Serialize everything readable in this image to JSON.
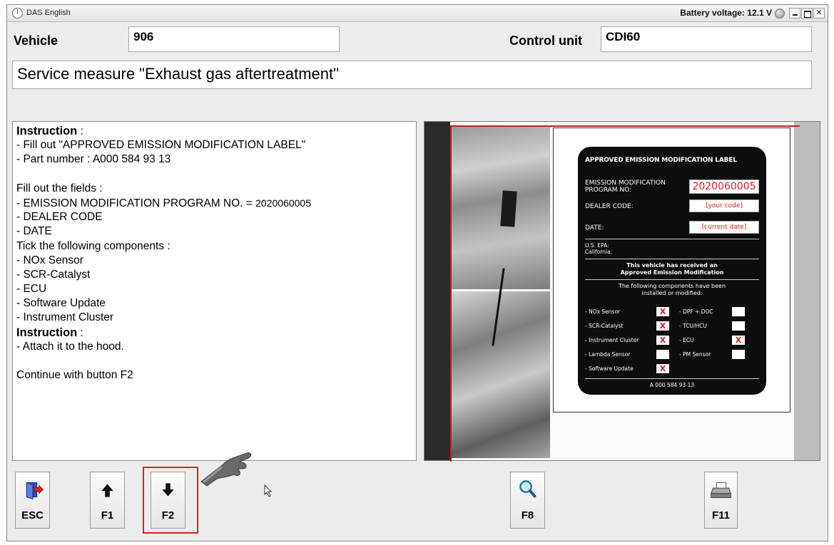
{
  "window": {
    "title": "DAS English",
    "battery": "Battery voltage: 12.1 V"
  },
  "header": {
    "vehicle_label": "Vehicle",
    "vehicle_value": "906",
    "control_unit_label": "Control unit",
    "control_unit_value": "CDI60"
  },
  "service_measure": "Service measure \"Exhaust gas aftertreatment\"",
  "instructions": {
    "lines": [
      {
        "text": "Instruction",
        "suffix": " :",
        "bold": true
      },
      {
        "text": "- Fill out \"APPROVED EMISSION MODIFICATION LABEL\""
      },
      {
        "text": "- Part number : A000 584 93 13"
      },
      {
        "text": ""
      },
      {
        "text": "Fill out the fields :"
      },
      {
        "text": "- EMISSION MODIFICATION PROGRAM NO. = ",
        "small": "2020060005"
      },
      {
        "text": "- DEALER CODE"
      },
      {
        "text": "- DATE"
      },
      {
        "text": "Tick the following components :"
      },
      {
        "text": "- NOx Sensor"
      },
      {
        "text": "- SCR-Catalyst"
      },
      {
        "text": "- ECU"
      },
      {
        "text": "- Software Update"
      },
      {
        "text": "- Instrument Cluster"
      },
      {
        "text": "Instruction",
        "suffix": " :",
        "bold": true
      },
      {
        "text": "- Attach it to the hood."
      },
      {
        "text": ""
      },
      {
        "text": "Continue with button F2"
      }
    ]
  },
  "emission_label": {
    "title": "APPROVED EMISSION MODIFICATION LABEL",
    "program_label_1": "EMISSION MODIFICATION",
    "program_label_2": "PROGRAM NO:",
    "program_value": "2020060005",
    "dealer_label": "DEALER CODE:",
    "dealer_value": "[your code]",
    "date_label": "DATE:",
    "date_value": "[current date]",
    "epa": "U.S. EPA:",
    "california": "California:",
    "received_1": "This vehicle has received an",
    "received_2": "Approved Emission Modification",
    "components_1": "The following components have been",
    "components_2": "installed or modified:",
    "left_components": [
      {
        "name": "- NOx Sensor",
        "mark": "X"
      },
      {
        "name": "- SCR-Catalyst",
        "mark": "X"
      },
      {
        "name": "- Instrument Cluster",
        "mark": "X"
      },
      {
        "name": "- Lambda Sensor",
        "mark": ""
      },
      {
        "name": "- Software Update",
        "mark": "X"
      }
    ],
    "right_components": [
      {
        "name": "- DPF + DOC",
        "mark": ""
      },
      {
        "name": "- TCU/HCU",
        "mark": ""
      },
      {
        "name": "- ECU",
        "mark": "X"
      },
      {
        "name": "- PM Sensor",
        "mark": ""
      }
    ],
    "part_number": "A 000 584 93 13"
  },
  "buttons": {
    "esc": {
      "key": "ESC",
      "icon": "exit-door-icon"
    },
    "f1": {
      "key": "F1",
      "icon": "arrow-up-icon"
    },
    "f2": {
      "key": "F2",
      "icon": "arrow-down-icon"
    },
    "f8": {
      "key": "F8",
      "icon": "magnifier-icon"
    },
    "f11": {
      "key": "F11",
      "icon": "printer-icon"
    }
  },
  "colors": {
    "highlight": "#e02020",
    "label_red": "#d21f1f",
    "label_bg": "#0d0d0d"
  }
}
